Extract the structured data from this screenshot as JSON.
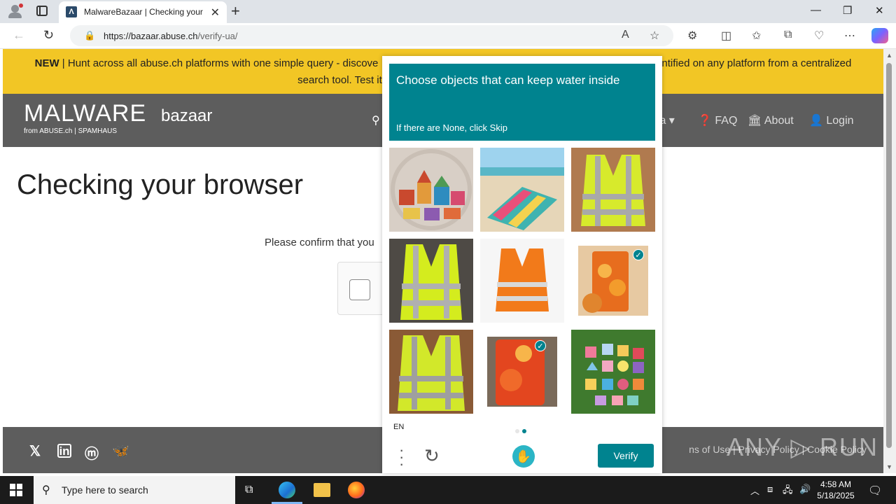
{
  "browser": {
    "tab_title": "MalwareBazaar | Checking your bro",
    "tab_favicon": "Λ",
    "url_host": "https://bazaar.abuse.ch",
    "url_path": "/verify-ua/"
  },
  "site": {
    "banner_new": "NEW",
    "banner_text_1": " | Hunt across all abuse.ch platforms with one simple query - discove",
    "banner_text_2": "ntified on any platform from a centralized",
    "banner_text_3": "search tool. Test it out",
    "logo_main": "MALWARE",
    "logo_sub": "bazaar",
    "logo_from": "from ABUSE.ch | SPAMHAUS",
    "nav": {
      "data_partial": "ta ▾",
      "faq": "FAQ",
      "about": "About",
      "login": "Login"
    },
    "page_title": "Checking your browser",
    "confirm_text": "Please confirm that you",
    "footer_links": "ns of Use  |  Privacy Policy  |  Cookie Policy",
    "watermark": "ANY ▷ RUN"
  },
  "captcha": {
    "question": "Choose objects that can keep water inside",
    "hint": "If there are None, click Skip",
    "language": "EN",
    "verify_label": "Verify",
    "tiles": [
      {
        "name": "toy-blocks",
        "selected": false
      },
      {
        "name": "beach-towel",
        "selected": false
      },
      {
        "name": "yellow-vest",
        "selected": false
      },
      {
        "name": "yellow-vest",
        "selected": false
      },
      {
        "name": "orange-vest",
        "selected": false
      },
      {
        "name": "iced-tea-glass",
        "selected": true
      },
      {
        "name": "yellow-vest",
        "selected": false
      },
      {
        "name": "iced-tea-glass",
        "selected": true
      },
      {
        "name": "shape-blocks",
        "selected": false
      }
    ]
  },
  "taskbar": {
    "search_placeholder": "Type here to search",
    "time": "4:58 AM",
    "date": "5/18/2025"
  },
  "colors": {
    "accent": "#00838f",
    "banner": "#f2c625",
    "header": "#5d5d5d"
  }
}
